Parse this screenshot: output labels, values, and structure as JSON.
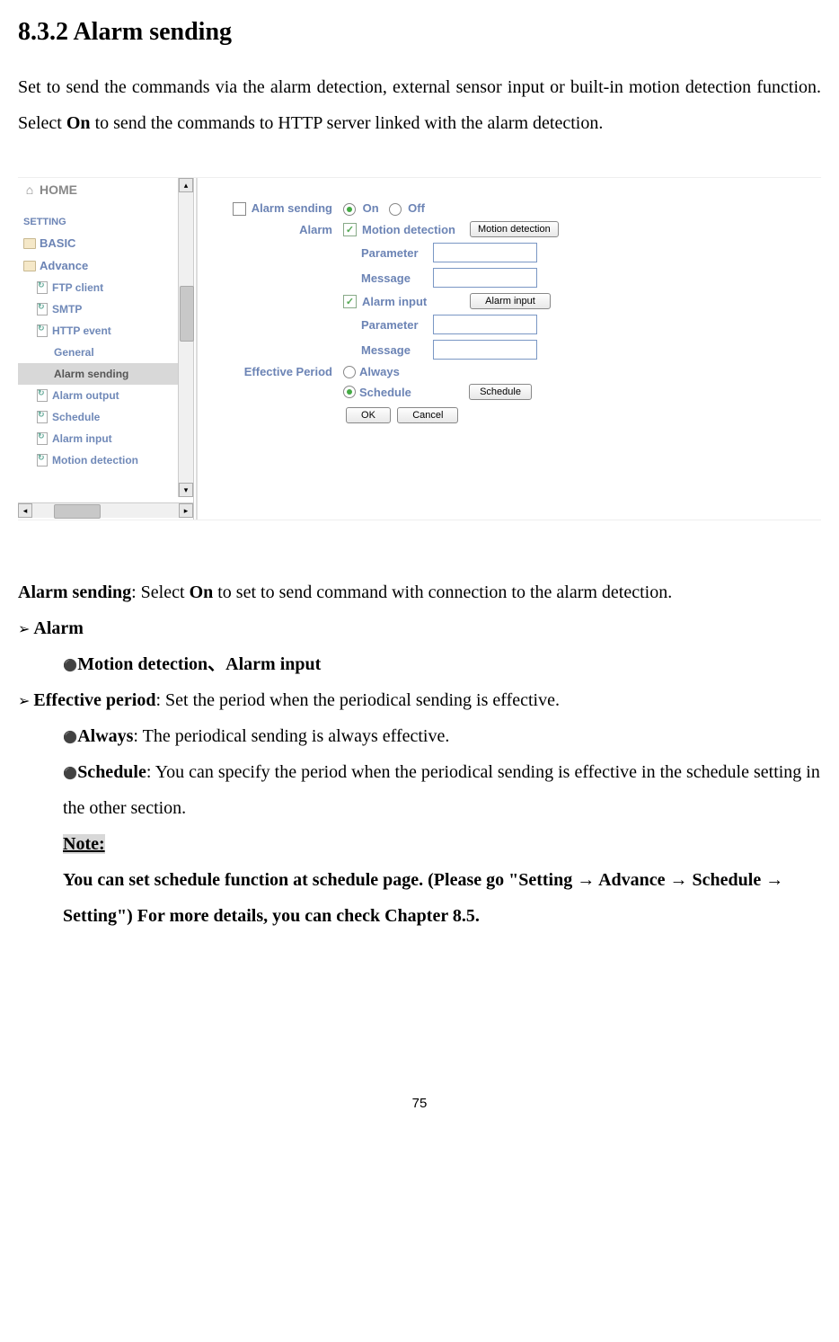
{
  "heading": "8.3.2 Alarm sending",
  "intro": {
    "part1": "Set to send the commands via the alarm detection, external sensor input or built-in motion detection function. Select ",
    "bold1": "On",
    "part2": " to send the commands to HTTP server linked with the alarm detection."
  },
  "screenshot": {
    "nav": {
      "home": "HOME",
      "setting": "SETTING",
      "basic": "BASIC",
      "advance": "Advance",
      "ftp": "FTP client",
      "smtp": "SMTP",
      "http": "HTTP event",
      "general": "General",
      "alarm_sending": "Alarm sending",
      "alarm_output": "Alarm output",
      "schedule": "Schedule",
      "alarm_input": "Alarm input",
      "motion_detection": "Motion detection"
    },
    "form": {
      "alarm_sending_label": "Alarm sending",
      "on": "On",
      "off": "Off",
      "alarm_label": "Alarm",
      "motion_detection": "Motion detection",
      "motion_detection_btn": "Motion detection",
      "parameter": "Parameter",
      "message": "Message",
      "alarm_input": "Alarm input",
      "alarm_input_btn": "Alarm input",
      "effective_period": "Effective Period",
      "always": "Always",
      "schedule": "Schedule",
      "schedule_btn": "Schedule",
      "ok": "OK",
      "cancel": "Cancel"
    }
  },
  "description": {
    "alarm_sending_bold": "Alarm sending",
    "alarm_sending_text": ": Select ",
    "alarm_sending_on": "On",
    "alarm_sending_text2": " to set to send command with connection to the alarm detection.",
    "alarm_heading": "Alarm",
    "motion_alarm_input": "Motion detection、Alarm input",
    "effective_period_bold": "Effective period",
    "effective_period_text": ": Set the period when the periodical sending is effective.",
    "always_bold": "Always",
    "always_text": ": The periodical sending is always effective.",
    "schedule_bold": "Schedule",
    "schedule_text": ": You can specify the period when the periodical sending is effective in the schedule setting in the other section.",
    "note_label": "Note: ",
    "note_text1": "You can set schedule function at schedule page. (Please go \"Setting → Advance → Schedule → Setting\") For more details, you can check Chapter 8.5."
  },
  "page_number": "75"
}
